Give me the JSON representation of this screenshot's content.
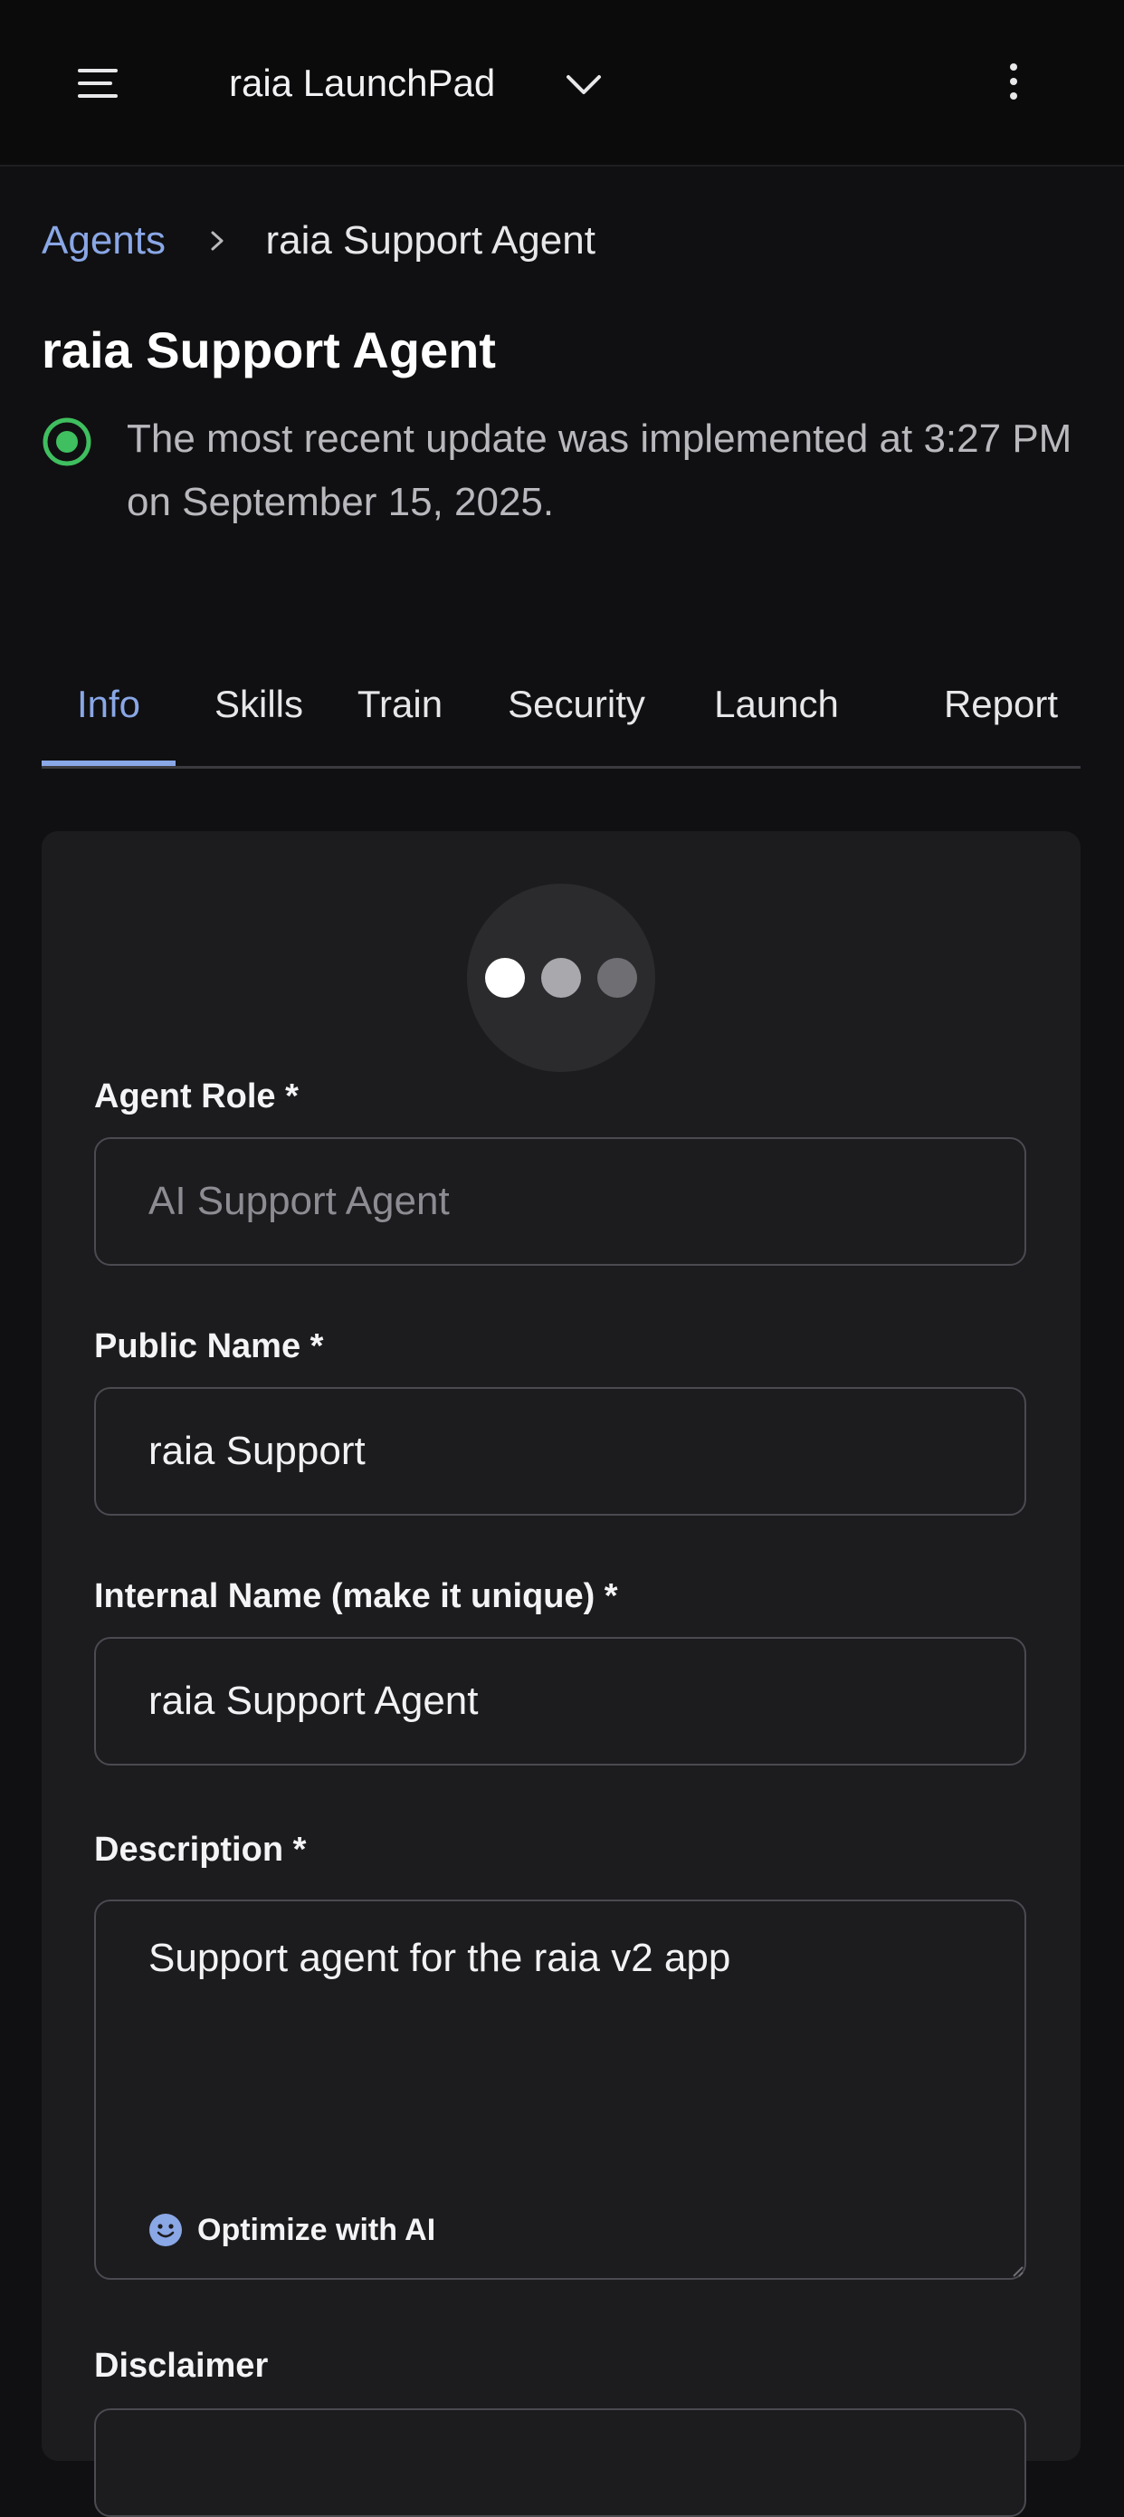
{
  "header": {
    "app_title": "raia LaunchPad",
    "menu_icon": "hamburger-menu-icon",
    "dropdown_icon": "chevron-down-icon",
    "more_icon": "vertical-dots-icon"
  },
  "breadcrumb": {
    "parent": "Agents",
    "current": "raia Support Agent"
  },
  "page": {
    "title": "raia Support Agent",
    "status_text": "The most recent update was implemented at 3:27 PM on September 15, 2025.",
    "status_color": "#3fbf5f"
  },
  "tabs": [
    {
      "label": "Info",
      "active": true
    },
    {
      "label": "Skills",
      "active": false
    },
    {
      "label": "Train",
      "active": false
    },
    {
      "label": "Security",
      "active": false
    },
    {
      "label": "Launch",
      "active": false
    },
    {
      "label": "Report",
      "active": false
    }
  ],
  "form": {
    "agent_role": {
      "label": "Agent Role *",
      "value": "AI Support Agent"
    },
    "public_name": {
      "label": "Public Name *",
      "value": "raia Support"
    },
    "internal_name": {
      "label": "Internal Name (make it unique) *",
      "value": "raia Support Agent"
    },
    "description": {
      "label": "Description *",
      "value": "Support agent for the raia v2 app"
    },
    "optimize": {
      "label": "Optimize with AI",
      "icon": "smiley-face-icon"
    },
    "disclaimer": {
      "label": "Disclaimer"
    }
  },
  "colors": {
    "accent": "#8aa7e6",
    "background": "#101012",
    "card": "#1c1c1f"
  }
}
